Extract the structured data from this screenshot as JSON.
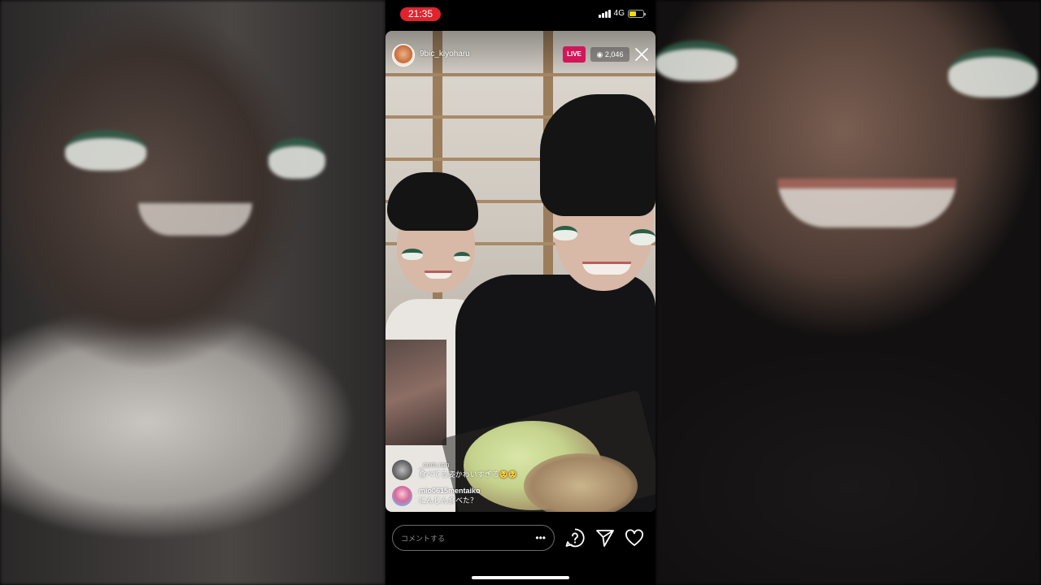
{
  "status_bar": {
    "time": "21:35",
    "network": "4G",
    "battery_level": 0.5
  },
  "live": {
    "host_username": "9bic_kiyoharu",
    "live_label": "LIVE",
    "viewer_count": "2,046"
  },
  "comments": [
    {
      "username": "_com.ran",
      "message": "食べてる姿かわいすぎる🥺🥺"
    },
    {
      "username": "mio0615mentaiko",
      "message": "にんじん食べた？"
    }
  ],
  "composer": {
    "placeholder": "コメントする",
    "more_icon": "more-horizontal-icon"
  },
  "controls": {
    "icons": [
      "question-sticker-icon",
      "send-icon",
      "heart-icon"
    ]
  },
  "colors": {
    "time_pill": "#e0242e",
    "live_badge": "#d1175a",
    "battery": "#f5d90a"
  }
}
